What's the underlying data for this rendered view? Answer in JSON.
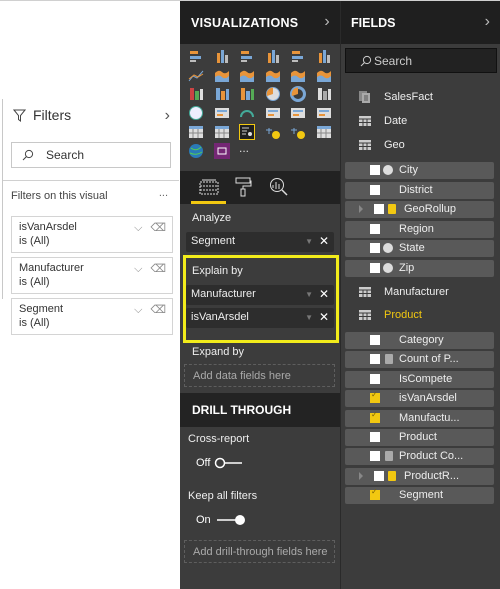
{
  "filters": {
    "title": "Filters",
    "search_placeholder": "Search",
    "section": "Filters on this visual",
    "more": "...",
    "cards": [
      {
        "field": "isVanArsdel",
        "condition": "is (All)"
      },
      {
        "field": "Manufacturer",
        "condition": "is (All)"
      },
      {
        "field": "Segment",
        "condition": "is (All)"
      }
    ]
  },
  "visualizations": {
    "title": "VISUALIZATIONS",
    "more_label": "...",
    "analyze_label": "Analyze",
    "analyze_field": "Segment",
    "explain_label": "Explain by",
    "explain_fields": [
      "Manufacturer",
      "isVanArsdel"
    ],
    "expand_label": "Expand by",
    "expand_placeholder": "Add data fields here",
    "drill_title": "DRILL THROUGH",
    "cross_report_label": "Cross-report",
    "cross_report_state": "Off",
    "keep_filters_label": "Keep all filters",
    "keep_filters_state": "On",
    "drill_placeholder": "Add drill-through fields here",
    "accent": "#f2c811",
    "highlight": "#f2ec1b"
  },
  "fields": {
    "title": "FIELDS",
    "search_placeholder": "Search",
    "tables_top": [
      "SalesFact",
      "Date",
      "Geo"
    ],
    "geo_fields": [
      {
        "name": "City",
        "checked": false,
        "icon": "globe"
      },
      {
        "name": "District",
        "checked": false,
        "icon": ""
      },
      {
        "name": "GeoRollup",
        "checked": false,
        "icon": "hierarchy"
      },
      {
        "name": "Region",
        "checked": false,
        "icon": ""
      },
      {
        "name": "State",
        "checked": false,
        "icon": "globe"
      },
      {
        "name": "Zip",
        "checked": false,
        "icon": "globe"
      }
    ],
    "manufacturer_table": "Manufacturer",
    "product_table": "Product",
    "product_fields": [
      {
        "name": "Category",
        "checked": false,
        "icon": ""
      },
      {
        "name": "Count of P...",
        "checked": false,
        "icon": "calc"
      },
      {
        "name": "IsCompete",
        "checked": false,
        "icon": ""
      },
      {
        "name": "isVanArsdel",
        "checked": true,
        "icon": ""
      },
      {
        "name": "Manufactu...",
        "checked": true,
        "icon": ""
      },
      {
        "name": "Product",
        "checked": false,
        "icon": ""
      },
      {
        "name": "Product Co...",
        "checked": false,
        "icon": "calc"
      },
      {
        "name": "ProductR...",
        "checked": false,
        "icon": "hierarchy"
      },
      {
        "name": "Segment",
        "checked": true,
        "icon": ""
      }
    ]
  }
}
